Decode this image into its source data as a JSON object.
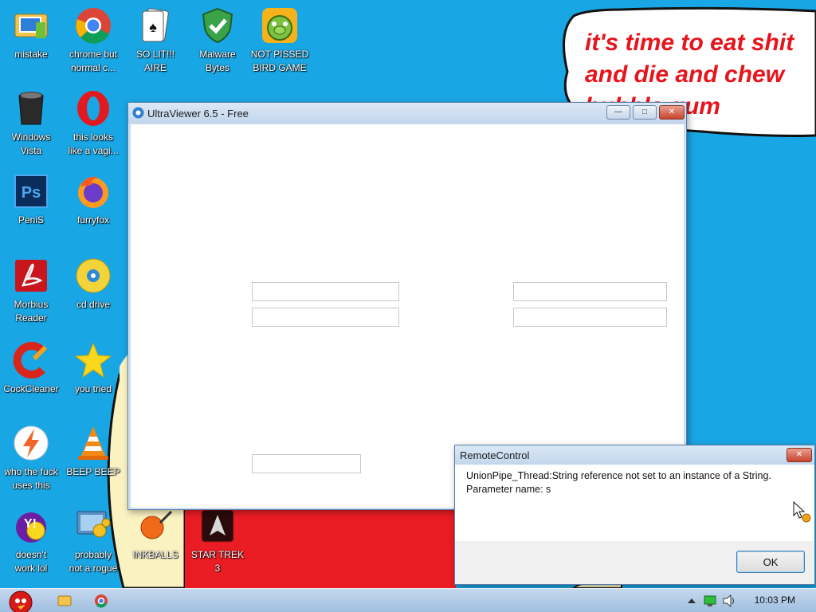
{
  "desktop": {
    "bubble_text": "it's time to eat shit\nand die and chew\nbubble gum",
    "icons": [
      {
        "label": "mistake",
        "icon": "folder-computer-icon"
      },
      {
        "label": "chrome but\nnormal c...",
        "icon": "chrome-icon"
      },
      {
        "label": "SO LIT!!!\nAIRE",
        "icon": "solitaire-icon"
      },
      {
        "label": "Malware\nBytes",
        "icon": "shield-check-icon"
      },
      {
        "label": "NOT PISSED\nBIRD GAME",
        "icon": "green-pig-icon"
      },
      {
        "label": "Windows\nVista",
        "icon": "trash-bin-icon"
      },
      {
        "label": "this looks\nlike a vagi...",
        "icon": "opera-icon"
      },
      {
        "label": "PeniS",
        "icon": "photoshop-icon"
      },
      {
        "label": "furryfox",
        "icon": "firefox-icon"
      },
      {
        "label": "Morbius\nReader",
        "icon": "pdf-reader-icon"
      },
      {
        "label": "cd drive",
        "icon": "cd-icon"
      },
      {
        "label": "CockCleaner",
        "icon": "ccleaner-icon"
      },
      {
        "label": "you tried",
        "icon": "star-icon"
      },
      {
        "label": "who the fuck\nuses this",
        "icon": "lightning-icon"
      },
      {
        "label": "BEEP BEEP",
        "icon": "vlc-cone-icon"
      },
      {
        "label": "doesn't\nwork lol",
        "icon": "yahoo-icon"
      },
      {
        "label": "probably\nnot a rogue",
        "icon": "monitor-gears-icon"
      },
      {
        "label": "INKBALLS",
        "icon": "ink-ball-icon"
      },
      {
        "label": "STAR TREK\n3",
        "icon": "star-trek-icon"
      }
    ]
  },
  "ultraviewer": {
    "title": "UltraViewer 6.5 - Free"
  },
  "dialog": {
    "title": "RemoteControl",
    "message_line1": "UnionPipe_Thread:String reference not set to an instance of a String.",
    "message_line2": "Parameter name: s",
    "ok_label": "OK"
  },
  "taskbar": {
    "clock": "10:03 PM",
    "start_icon": "angry-bird-start-icon"
  },
  "colors": {
    "desktop_bg": "#19a6e4",
    "bubble_text": "#e8141c",
    "dialog_accent": "#3c7fb1"
  }
}
